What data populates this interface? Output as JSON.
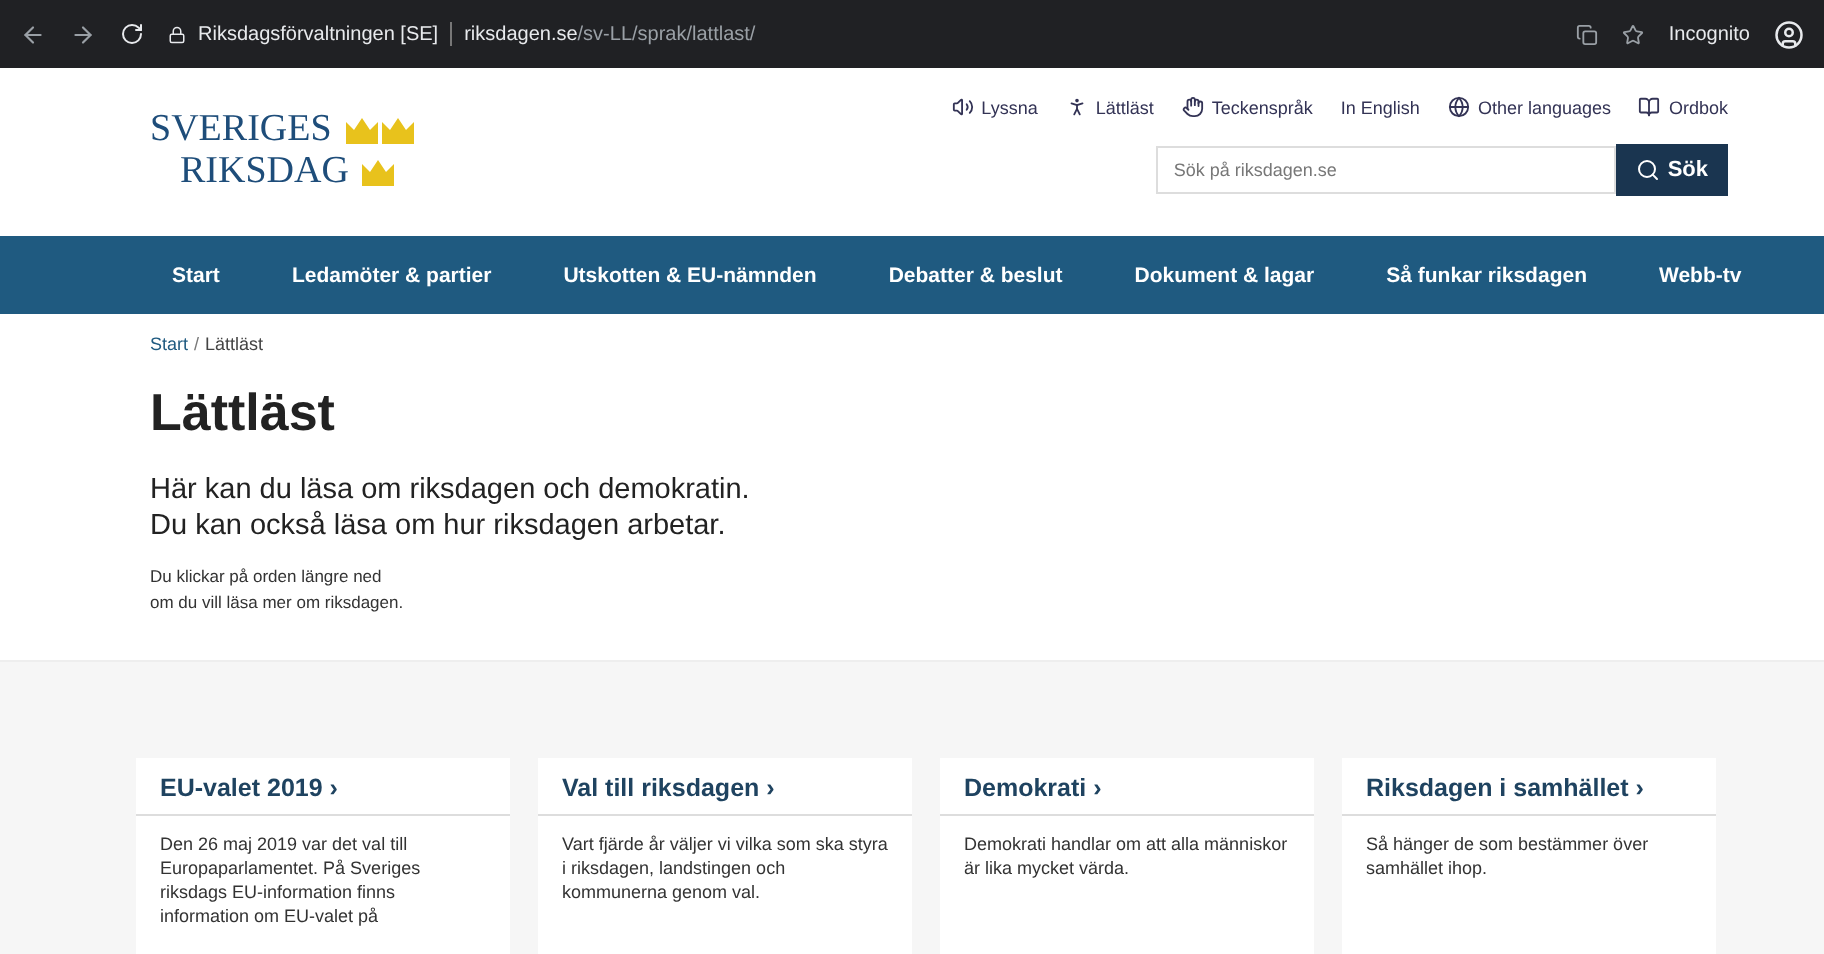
{
  "browser": {
    "site_label": "Riksdagsförvaltningen [SE]",
    "url_host": "riksdagen.se",
    "url_path": "/sv-LL/sprak/lattlast/",
    "profile": "Incognito"
  },
  "logo": {
    "line_1": "SVERIGES",
    "line_2": "RIKSDAG"
  },
  "tool_links": [
    "Lyssna",
    "Lättläst",
    "Teckenspråk",
    "In English",
    "Other languages",
    "Ordbok"
  ],
  "search": {
    "placeholder": "Sök på riksdagen.se",
    "button": "Sök"
  },
  "nav": [
    "Start",
    "Ledamöter & partier",
    "Utskotten & EU-nämnden",
    "Debatter & beslut",
    "Dokument & lagar",
    "Så funkar riksdagen",
    "Webb-tv"
  ],
  "breadcrumb": [
    "Start",
    "Lättläst"
  ],
  "breadcrumb_separator": "/",
  "title": "Lättläst",
  "lead": [
    "Här kan du läsa om riksdagen och demokratin.",
    "Du kan också läsa om hur riksdagen arbetar."
  ],
  "hint": [
    "Du klickar på orden längre ned",
    "om du vill läsa mer om riksdagen."
  ],
  "cards": [
    {
      "title": "EU-valet 2019 ›",
      "text": "Den 26 maj 2019 var det val till Europaparlamentet. På Sveriges riksdags EU-information finns information om EU-valet på"
    },
    {
      "title": "Val till riksdagen ›",
      "text": "Vart fjärde år väljer vi vilka som ska styra i riksdagen, landstingen och kommunerna genom val."
    },
    {
      "title": "Demokrati ›",
      "text": "Demokrati handlar om att alla människor är lika mycket värda."
    },
    {
      "title": "Riksdagen i samhället ›",
      "text": "Så hänger de som bestämmer över samhället ihop."
    }
  ]
}
